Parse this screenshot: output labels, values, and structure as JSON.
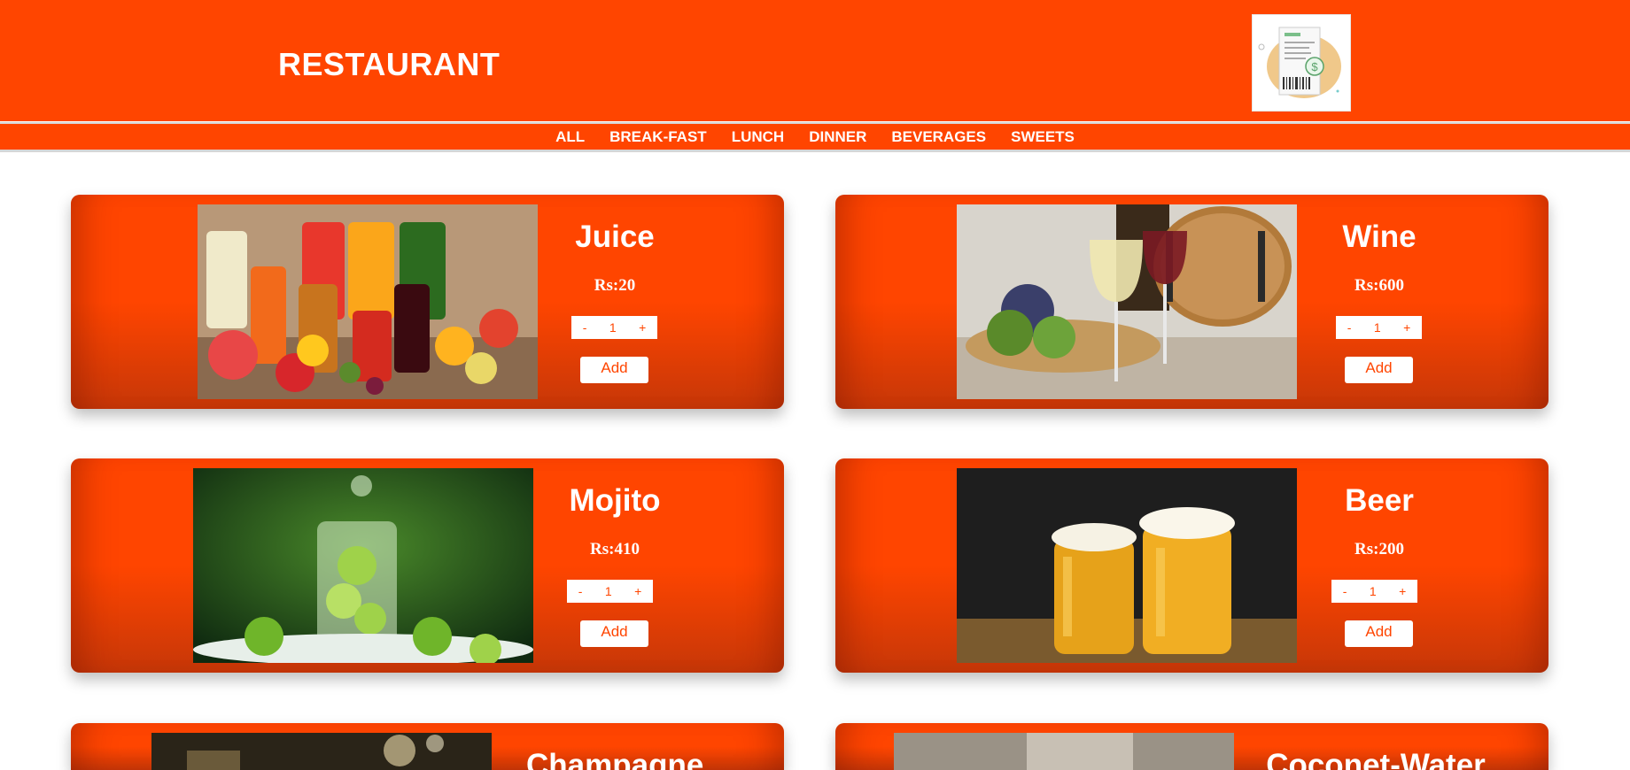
{
  "brand": {
    "title": "RESTAURANT"
  },
  "nav": {
    "items": [
      "ALL",
      "BREAK-FAST",
      "LUNCH",
      "DINNER",
      "BEVERAGES",
      "SWEETS"
    ]
  },
  "products": [
    {
      "name": "Juice",
      "price": "Rs:20",
      "quantity": "1",
      "minus": "-",
      "plus": "+",
      "add_label": "Add"
    },
    {
      "name": "Wine",
      "price": "Rs:600",
      "quantity": "1",
      "minus": "-",
      "plus": "+",
      "add_label": "Add"
    },
    {
      "name": "Mojito",
      "price": "Rs:410",
      "quantity": "1",
      "minus": "-",
      "plus": "+",
      "add_label": "Add"
    },
    {
      "name": "Beer",
      "price": "Rs:200",
      "quantity": "1",
      "minus": "-",
      "plus": "+",
      "add_label": "Add"
    },
    {
      "name": "Champagne"
    },
    {
      "name": "Coconet-Water"
    }
  ],
  "colors": {
    "accent": "#ff4500",
    "white": "#ffffff"
  },
  "icons": {
    "receipt": "receipt-icon"
  }
}
